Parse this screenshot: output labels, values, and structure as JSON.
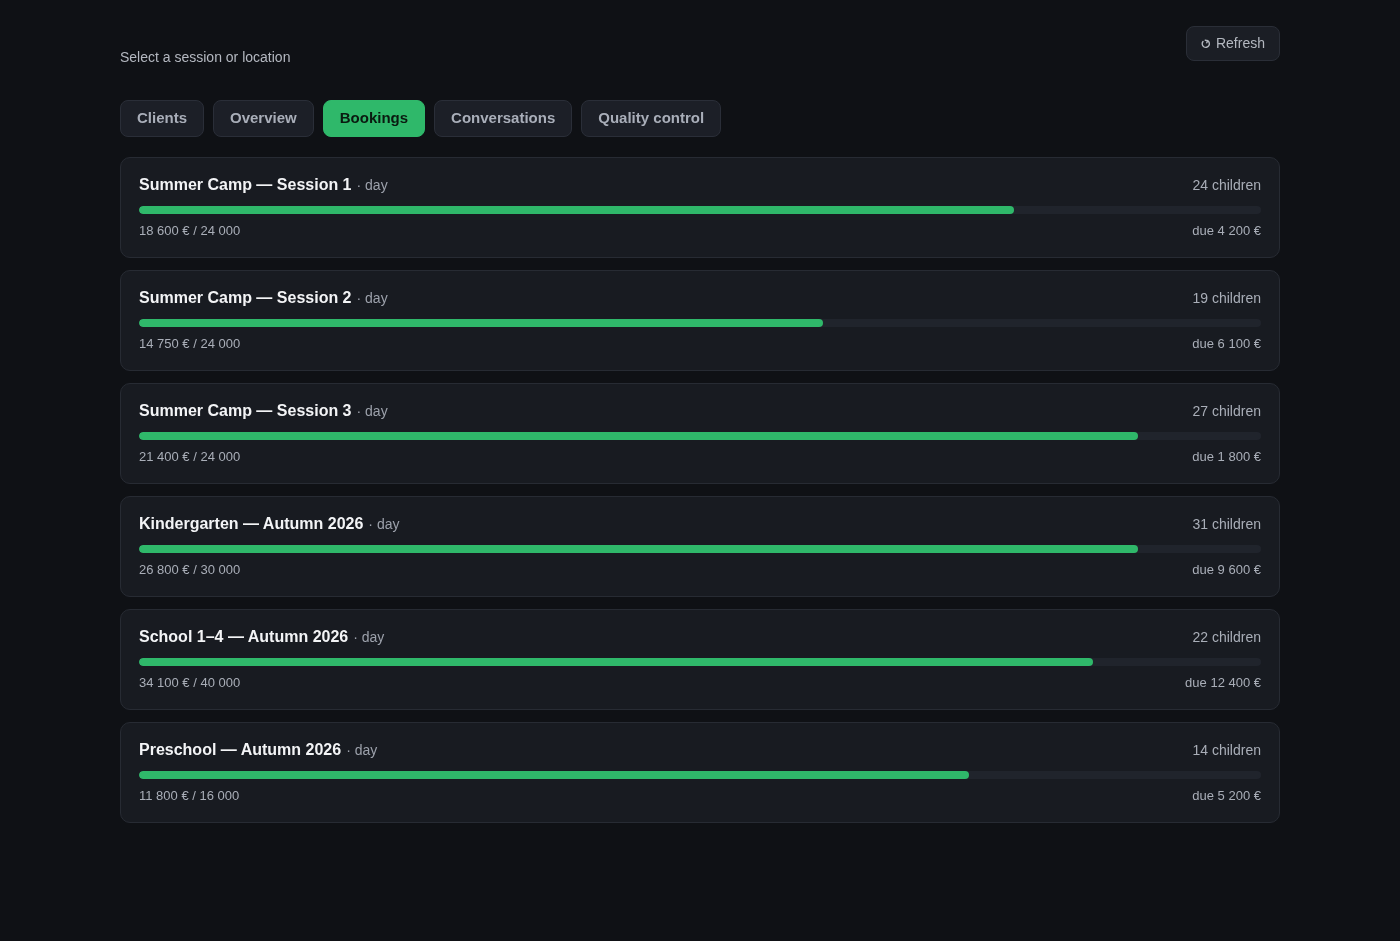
{
  "header": {
    "prompt": "Select a session or location",
    "refresh_button": "Refresh"
  },
  "tabs": [
    {
      "label": "Clients",
      "selected": false
    },
    {
      "label": "Overview",
      "selected": false
    },
    {
      "label": "Bookings",
      "selected": true
    },
    {
      "label": "Conversations",
      "selected": false
    },
    {
      "label": "Quality control",
      "selected": false
    }
  ],
  "sessions": [
    {
      "name": "Summer Camp — Session 1",
      "type": "· day",
      "children": "24 children",
      "level": 0.78,
      "amount": "18 600 € / 24 000",
      "due": "due 4 200 €"
    },
    {
      "name": "Summer Camp — Session 2",
      "type": "· day",
      "children": "19 children",
      "level": 0.61,
      "amount": "14 750 € / 24 000",
      "due": "due 6 100 €"
    },
    {
      "name": "Summer Camp — Session 3",
      "type": "· day",
      "children": "27 children",
      "level": 0.89,
      "amount": "21 400 € / 24 000",
      "due": "due 1 800 €"
    },
    {
      "name": "Kindergarten — Autumn 2026",
      "type": "· day",
      "children": "31 children",
      "level": 0.89,
      "amount": "26 800 € / 30 000",
      "due": "due 9 600 €"
    },
    {
      "name": "School 1–4 — Autumn 2026",
      "type": "· day",
      "children": "22 children",
      "level": 0.85,
      "amount": "34 100 € / 40 000",
      "due": "due 12 400 €"
    },
    {
      "name": "Preschool — Autumn 2026",
      "type": "· day",
      "children": "14 children",
      "level": 0.74,
      "amount": "11 800 € / 16 000",
      "due": "due 5 200 €"
    }
  ]
}
